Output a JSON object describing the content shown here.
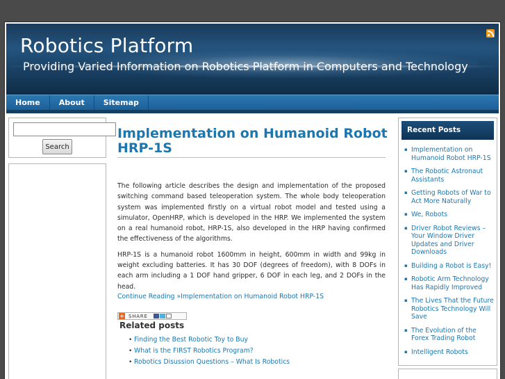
{
  "site": {
    "title": "Robotics Platform",
    "tagline": "Providing Varied Information on Robotics Platform in Computers and Technology"
  },
  "nav": [
    {
      "label": "Home"
    },
    {
      "label": "About"
    },
    {
      "label": "Sitemap"
    }
  ],
  "search": {
    "placeholder": "",
    "button_label": "Search"
  },
  "post": {
    "title": "Implementation on Humanoid Robot HRP-1S",
    "paragraphs": [
      "The following article describes the design and implementation of the proposed switching command based teleoperation system. The whole body teleoperation system was implemented firstly on a virtual robot model and tested using a simulator, OpenHRP, which is developed in the HRP. We implemented the system on a real humanoid robot, HRP-1S, also developed in the HRP having confirmed the effectiveness of the algorithms.",
      "HRP-1S is a humanoid robot 1600mm in height, 600mm in width and 99kg in weight excluding batteries. It has 30 DOF (degrees of freedom), with 8 DOFs in each arm including a 1 DOF hand gripper, 6 DOF in each leg, and 2 DOFs in the head."
    ],
    "continue_link": "Continue Reading »Implementation on Humanoid Robot HRP-1S",
    "share_label": "SHARE"
  },
  "related": {
    "title": "Related posts",
    "items": [
      "Finding the Best Robotic Toy to Buy",
      "What is the FIRST Robotics Program?",
      "Robotics Disussion Questions – What Is Robotics"
    ]
  },
  "recent_posts": {
    "title": "Recent Posts",
    "items": [
      "Implementation on Humanoid Robot HRP-1S",
      "The Robotic Astronaut Assistants",
      "Getting Robots of War to Act More Naturally",
      "We, Robots",
      "Driver Robot Reviews – Your Window Driver Updates and Driver Downloads",
      "Building a Robot is Easy!",
      "Robotic Arm Technology Has Rapidly Improved",
      "The Lives That the Future Robotics Technology Will Save",
      "The Evolution of the Forex Trading Robot",
      "Intelligent Robots"
    ]
  },
  "icons": {
    "rss": "rss-icon",
    "share_plus": "share-plus-icon"
  },
  "colors": {
    "link": "#1b77b0",
    "nav": "#1d5f96",
    "rss": "#f39a1d"
  }
}
